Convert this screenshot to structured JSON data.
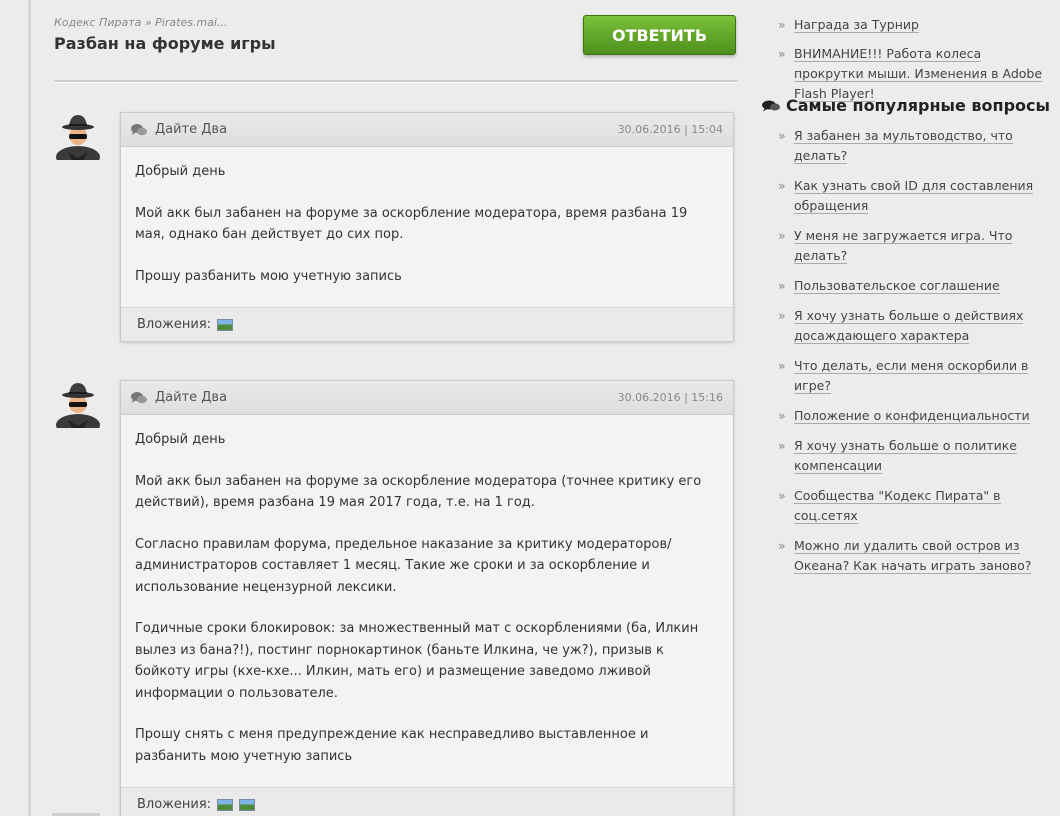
{
  "breadcrumb": "Кодекс Пирата » Pirates.mai...",
  "page_title": "Разбан на форуме игры",
  "reply_button": "ОТВЕТИТЬ",
  "colors": {
    "accent_green": "#5ea62a",
    "background": "#ececec"
  },
  "posts": [
    {
      "author": "Дайте Два",
      "date": "30.06.2016 | 15:04",
      "paragraphs": [
        "Добрый день",
        "Мой акк был забанен на форуме за оскорбление модератора, время разбана 19 мая, однако бан действует до сих пор.",
        "Прошу разбанить мою учетную запись"
      ],
      "attachments_label": "Вложения:",
      "attachments_count": 1
    },
    {
      "author": "Дайте Два",
      "date": "30.06.2016 | 15:16",
      "paragraphs": [
        "Добрый день",
        "Мой акк был забанен на форуме за оскорбление модератора (точнее критику его действий), время разбана 19 мая 2017 года, т.е. на 1 год.",
        "Согласно правилам форума, предельное наказание за критику модераторов/администраторов составляет 1 месяц. Такие же сроки и за оскорбление и использование нецензурной лексики.",
        "Годичные сроки блокировок: за множественный мат с оскорблениями (ба, Илкин вылез из бана?!), постинг порнокартинок (баньте Илкина, че уж?), призыв к бойкоту игры (кхе-кхе... Илкин, мать его) и размещение заведомо лживой информации о пользователе.",
        "Прошу снять с меня предупреждение как несправедливо выставленное и разбанить мою учетную запись"
      ],
      "attachments_label": "Вложения:",
      "attachments_count": 2
    }
  ],
  "sidebar": {
    "top_links": [
      "Награда за Турнир",
      "ВНИМАНИЕ!!! Работа колеса прокрутки мыши. Изменения в Adobe Flash Player!"
    ],
    "popular_heading": "Самые популярные вопросы",
    "popular_links": [
      "Я забанен за мультоводство, что делать?",
      "Как узнать свой ID для составления обращения",
      "У меня не загружается игра. Что делать?",
      "Пользовательское соглашение",
      "Я хочу узнать больше о действиях досаждающего характера",
      "Что делать, если меня оскорбили в игре?",
      "Положение о конфиденциальности",
      "Я хочу узнать больше о политике компенсации",
      "Сообщества \"Кодекс Пирата\" в соц.сетях",
      "Можно ли удалить свой остров из Океана? Как начать играть заново?"
    ]
  }
}
